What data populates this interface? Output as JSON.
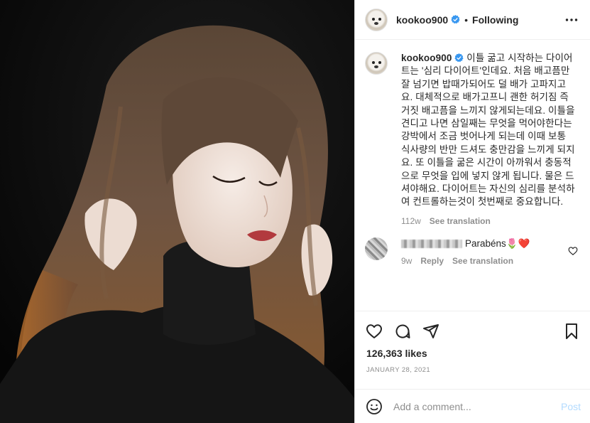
{
  "post": {
    "username": "kookoo900",
    "follow_status": "Following",
    "dot": "•"
  },
  "caption": {
    "username": "kookoo900",
    "text": "이틀 굶고 시작하는 다이어트는 '심리 다이어트'인데요. 처음 배고픔만 잘 넘기면 밥때가되어도 덜 배가 고파지고요. 대체적으로 배가고프니 괜한 허기짐 즉 거짓 배고픔을 느끼지 않게되는데요. 이틀을 견디고 나면 삼일째는 무엇을 먹어야한다는 강박에서 조금 벗어나게 되는데 이때 보통 식사량의 반만 드셔도 충만감을 느끼게 되지요. 또 이틀을 굶은 시간이 아까워서 충동적으로 무엇을 입에 넣지 않게 됩니다. 물은 드셔야해요. 다이어트는 자신의 심리를 분석하여 컨트롤하는것이 첫번째로 중요합니다.",
    "age": "112w",
    "see_translation": "See translation"
  },
  "comments": [
    {
      "text": "Parabéns🌷❤️",
      "age": "9w",
      "reply": "Reply",
      "see_translation": "See translation"
    }
  ],
  "likes": "126,363 likes",
  "date": "JANUARY 28, 2021",
  "add_comment": {
    "placeholder": "Add a comment...",
    "post_label": "Post"
  },
  "colors": {
    "verified_blue": "#3897f0",
    "post_disabled": "#b3dbff",
    "muted": "#8e8e8e",
    "text": "#262626"
  },
  "icons": [
    "verified-badge-icon",
    "more-options-icon",
    "heart-icon",
    "comment-icon",
    "share-icon",
    "bookmark-icon",
    "emoji-icon"
  ]
}
